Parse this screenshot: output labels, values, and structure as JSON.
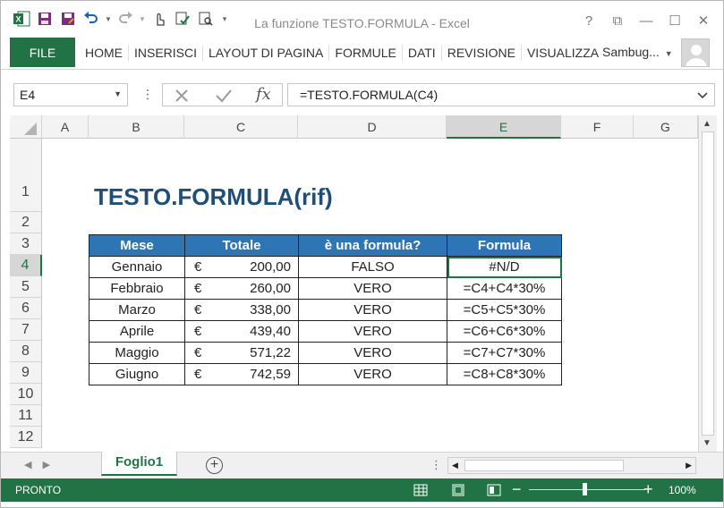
{
  "window": {
    "title": "La funzione TESTO.FORMULA - Excel",
    "buttons": [
      "?",
      "⧉",
      "—",
      "☐",
      "✕"
    ]
  },
  "ribbon": {
    "file_label": "FILE",
    "tabs": [
      "HOME",
      "INSERISCI",
      "LAYOUT DI PAGINA",
      "FORMULE",
      "DATI",
      "REVISIONE",
      "VISUALIZZA"
    ],
    "user": "Sambug..."
  },
  "formula_bar": {
    "name_box": "E4",
    "fx": "fx",
    "formula": "=TESTO.FORMULA(C4)"
  },
  "grid": {
    "columns": [
      "A",
      "B",
      "C",
      "D",
      "E",
      "F",
      "G"
    ],
    "rows": [
      "1",
      "2",
      "3",
      "4",
      "5",
      "6",
      "7",
      "8",
      "9",
      "10",
      "11",
      "12"
    ],
    "selected_column": "E",
    "selected_row": "4"
  },
  "sheet": {
    "heading": "TESTO.FORMULA(rif)",
    "table": {
      "headers": [
        "Mese",
        "Totale",
        "è una formula?",
        "Formula"
      ],
      "currency": "€",
      "rows": [
        {
          "mese": "Gennaio",
          "totale": "200,00",
          "formula_check": "FALSO",
          "formula": "#N/D"
        },
        {
          "mese": "Febbraio",
          "totale": "260,00",
          "formula_check": "VERO",
          "formula": "=C4+C4*30%"
        },
        {
          "mese": "Marzo",
          "totale": "338,00",
          "formula_check": "VERO",
          "formula": "=C5+C5*30%"
        },
        {
          "mese": "Aprile",
          "totale": "439,40",
          "formula_check": "VERO",
          "formula": "=C6+C6*30%"
        },
        {
          "mese": "Maggio",
          "totale": "571,22",
          "formula_check": "VERO",
          "formula": "=C7+C7*30%"
        },
        {
          "mese": "Giugno",
          "totale": "742,59",
          "formula_check": "VERO",
          "formula": "=C8+C8*30%"
        }
      ]
    }
  },
  "sheet_tabs": {
    "active": "Foglio1",
    "add": "+"
  },
  "status": {
    "ready": "PRONTO",
    "zoom": "100%"
  },
  "colors": {
    "excel_green": "#217346",
    "header_blue": "#2e75b6",
    "heading_blue": "#1f4e79"
  }
}
